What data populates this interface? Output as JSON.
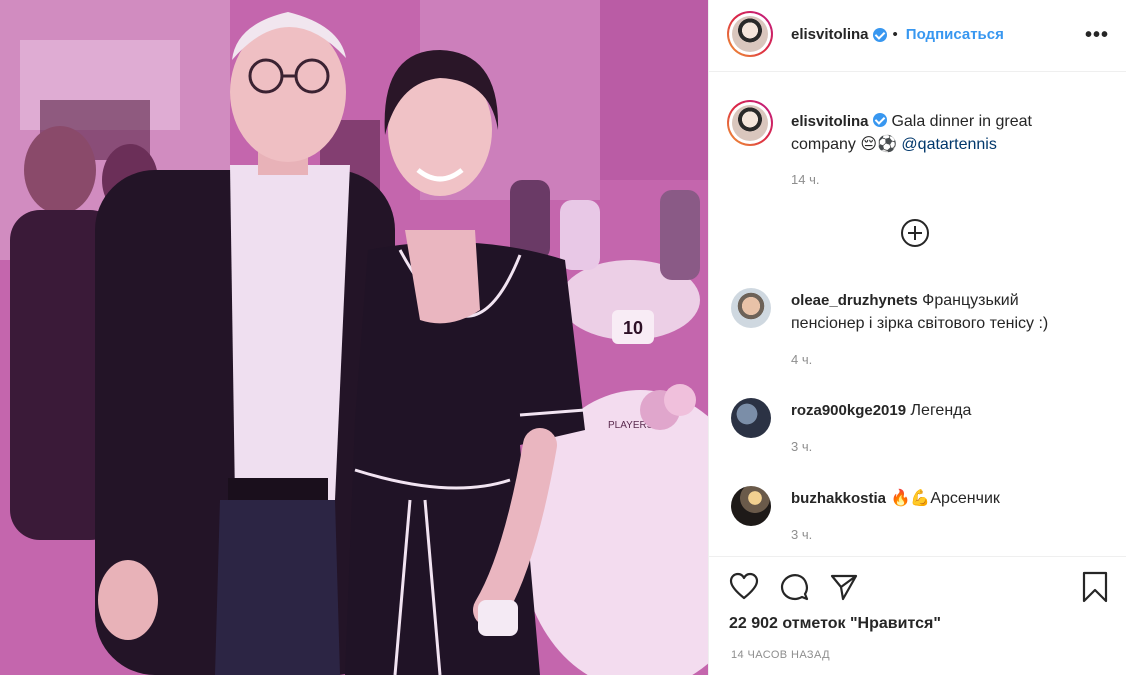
{
  "post": {
    "username": "elisvitolina",
    "follow_label": "Подписаться",
    "separator": "•",
    "more_label": "•••"
  },
  "caption": {
    "username": "elisvitolina",
    "text": "Gala dinner in great company 😔⚽ ",
    "mention": "@qatartennis",
    "time": "14 ч."
  },
  "photo": {
    "table_number": "10",
    "table_card": "PLAYERS"
  },
  "comments": [
    {
      "username": "oleae_druzhynets",
      "text": "Французький пенсіонер і зірка світового тенісу :)",
      "time": "4 ч."
    },
    {
      "username": "roza900kge2019",
      "text": "Легенда",
      "time": "3 ч."
    },
    {
      "username": "buzhakkostia",
      "text": "🔥💪Арсенчик",
      "time": "3 ч."
    }
  ],
  "footer": {
    "likes": "22 902 отметок \"Нравится\"",
    "posted_ago": "14 ЧАСОВ НАЗАД"
  },
  "colors": {
    "accent": "#3897f0",
    "mention": "#00376b",
    "muted": "#8e8e8e",
    "photo_tint": "#c868b0"
  },
  "icons": [
    "verified-badge-icon",
    "more-options-icon",
    "load-more-comments-icon",
    "heart-icon",
    "comment-icon",
    "share-icon",
    "bookmark-icon"
  ]
}
